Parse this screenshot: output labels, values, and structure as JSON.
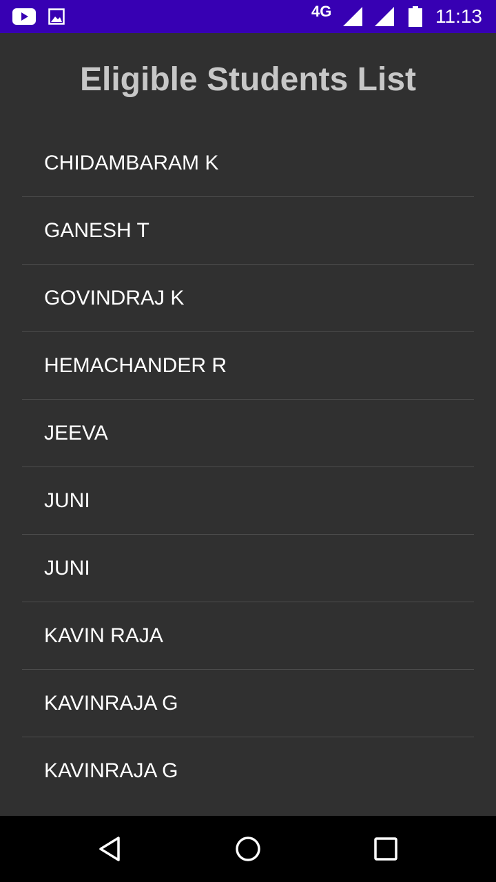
{
  "status_bar": {
    "network": "4G",
    "time": "11:13",
    "icons": [
      "youtube-icon",
      "gallery-icon",
      "signal-icon",
      "signal-icon",
      "battery-icon"
    ]
  },
  "page": {
    "title": "Eligible Students List"
  },
  "students": [
    {
      "name": "CHIDAMBARAM K"
    },
    {
      "name": "GANESH T"
    },
    {
      "name": "GOVINDRAJ K"
    },
    {
      "name": "HEMACHANDER R"
    },
    {
      "name": "JEEVA"
    },
    {
      "name": "JUNI"
    },
    {
      "name": "JUNI"
    },
    {
      "name": "KAVIN RAJA"
    },
    {
      "name": "KAVINRAJA G"
    },
    {
      "name": "KAVINRAJA G"
    }
  ],
  "nav_bar": {
    "icons": [
      "back-icon",
      "home-icon",
      "recent-apps-icon"
    ]
  },
  "colors": {
    "status_bar": "#3700b3",
    "background": "#303030",
    "title": "#c7c7c7",
    "divider": "#4c4c4c"
  }
}
